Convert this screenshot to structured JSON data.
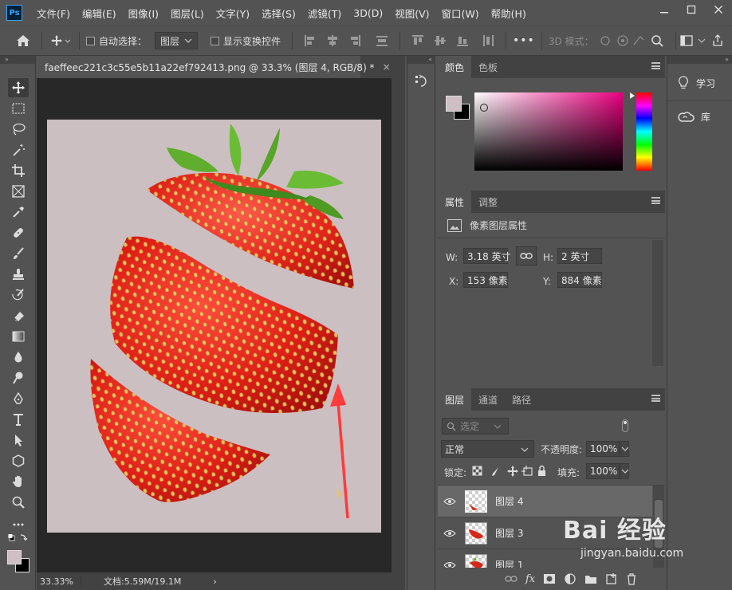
{
  "menubar": {
    "logo": "Ps",
    "items": [
      "文件(F)",
      "编辑(E)",
      "图像(I)",
      "图层(L)",
      "文字(Y)",
      "选择(S)",
      "滤镜(T)",
      "3D(D)",
      "视图(V)",
      "窗口(W)",
      "帮助(H)"
    ],
    "window_controls": [
      "minimize-icon",
      "maximize-icon",
      "close-icon"
    ]
  },
  "options": {
    "auto_select_label": "自动选择：",
    "auto_select_target": "图层",
    "show_transform_label": "显示变换控件",
    "more": "•••",
    "mode_3d": "3D 模式："
  },
  "document": {
    "tab_title": "faeffeec221c3c55e5b11a22ef792413.png @ 33.3% (图层 4, RGB/8) *",
    "tab_close": "×",
    "zoom": "33.33%",
    "doc_info": "文档:5.59M/19.1M",
    "status_arrow": "›"
  },
  "color_panel": {
    "tabs": [
      "颜色",
      "色板"
    ],
    "foreground": "#cdbfc3",
    "background": "#000000",
    "hue": "#e9007f"
  },
  "properties_panel": {
    "tabs": [
      "属性",
      "调整"
    ],
    "title": "像素图层属性",
    "w_label": "W:",
    "w_value": "3.18 英寸",
    "h_label": "H:",
    "h_value": "2 英寸",
    "x_label": "X:",
    "x_value": "153 像素",
    "y_label": "Y:",
    "y_value": "884 像素"
  },
  "layers_panel": {
    "tabs": [
      "图层",
      "通道",
      "路径"
    ],
    "filter_label": "选定",
    "blend_mode": "正常",
    "opacity_label": "不透明度:",
    "opacity_value": "100%",
    "lock_label": "锁定:",
    "fill_label": "填充:",
    "fill_value": "100%",
    "layers": [
      {
        "name": "图层 4",
        "selected": true
      },
      {
        "name": "图层 3",
        "selected": false
      },
      {
        "name": "图层 1",
        "selected": false
      }
    ],
    "footer_icons": [
      "link-icon",
      "fx-icon",
      "mask-icon",
      "adjustment-icon",
      "folder-icon",
      "new-layer-icon",
      "trash-icon"
    ],
    "fx_label": "fx"
  },
  "right_column": {
    "learn": "学习",
    "library": "库"
  },
  "watermark": {
    "brand": "Bai 经验",
    "url": "jingyan.baidu.com"
  },
  "annotation_color": "#ff3b3b"
}
